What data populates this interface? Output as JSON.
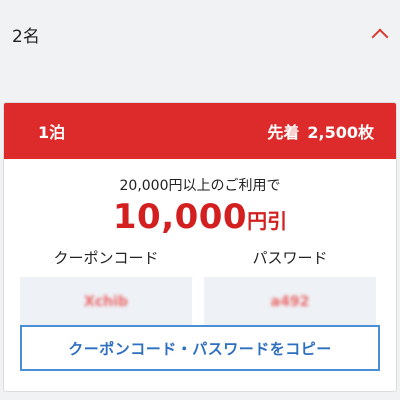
{
  "accordion": {
    "title": "2名",
    "icon": "chevron-up-icon"
  },
  "coupon": {
    "nights": "1泊",
    "stock_prefix": "先着",
    "stock": "2,500枚",
    "condition": "20,000円以上のご利用で",
    "discount_amount": "10,000",
    "discount_unit": "円引",
    "code_label": "クーポンコード",
    "code_value": "Xchib",
    "password_label": "パスワード",
    "password_value": "a492",
    "copy_button": "クーポンコード・パスワードをコピー",
    "colors": {
      "header": "#dd2a2a",
      "discount": "#d31f1f",
      "button_border": "#4a8fd6",
      "button_text": "#2f6fbf"
    }
  }
}
